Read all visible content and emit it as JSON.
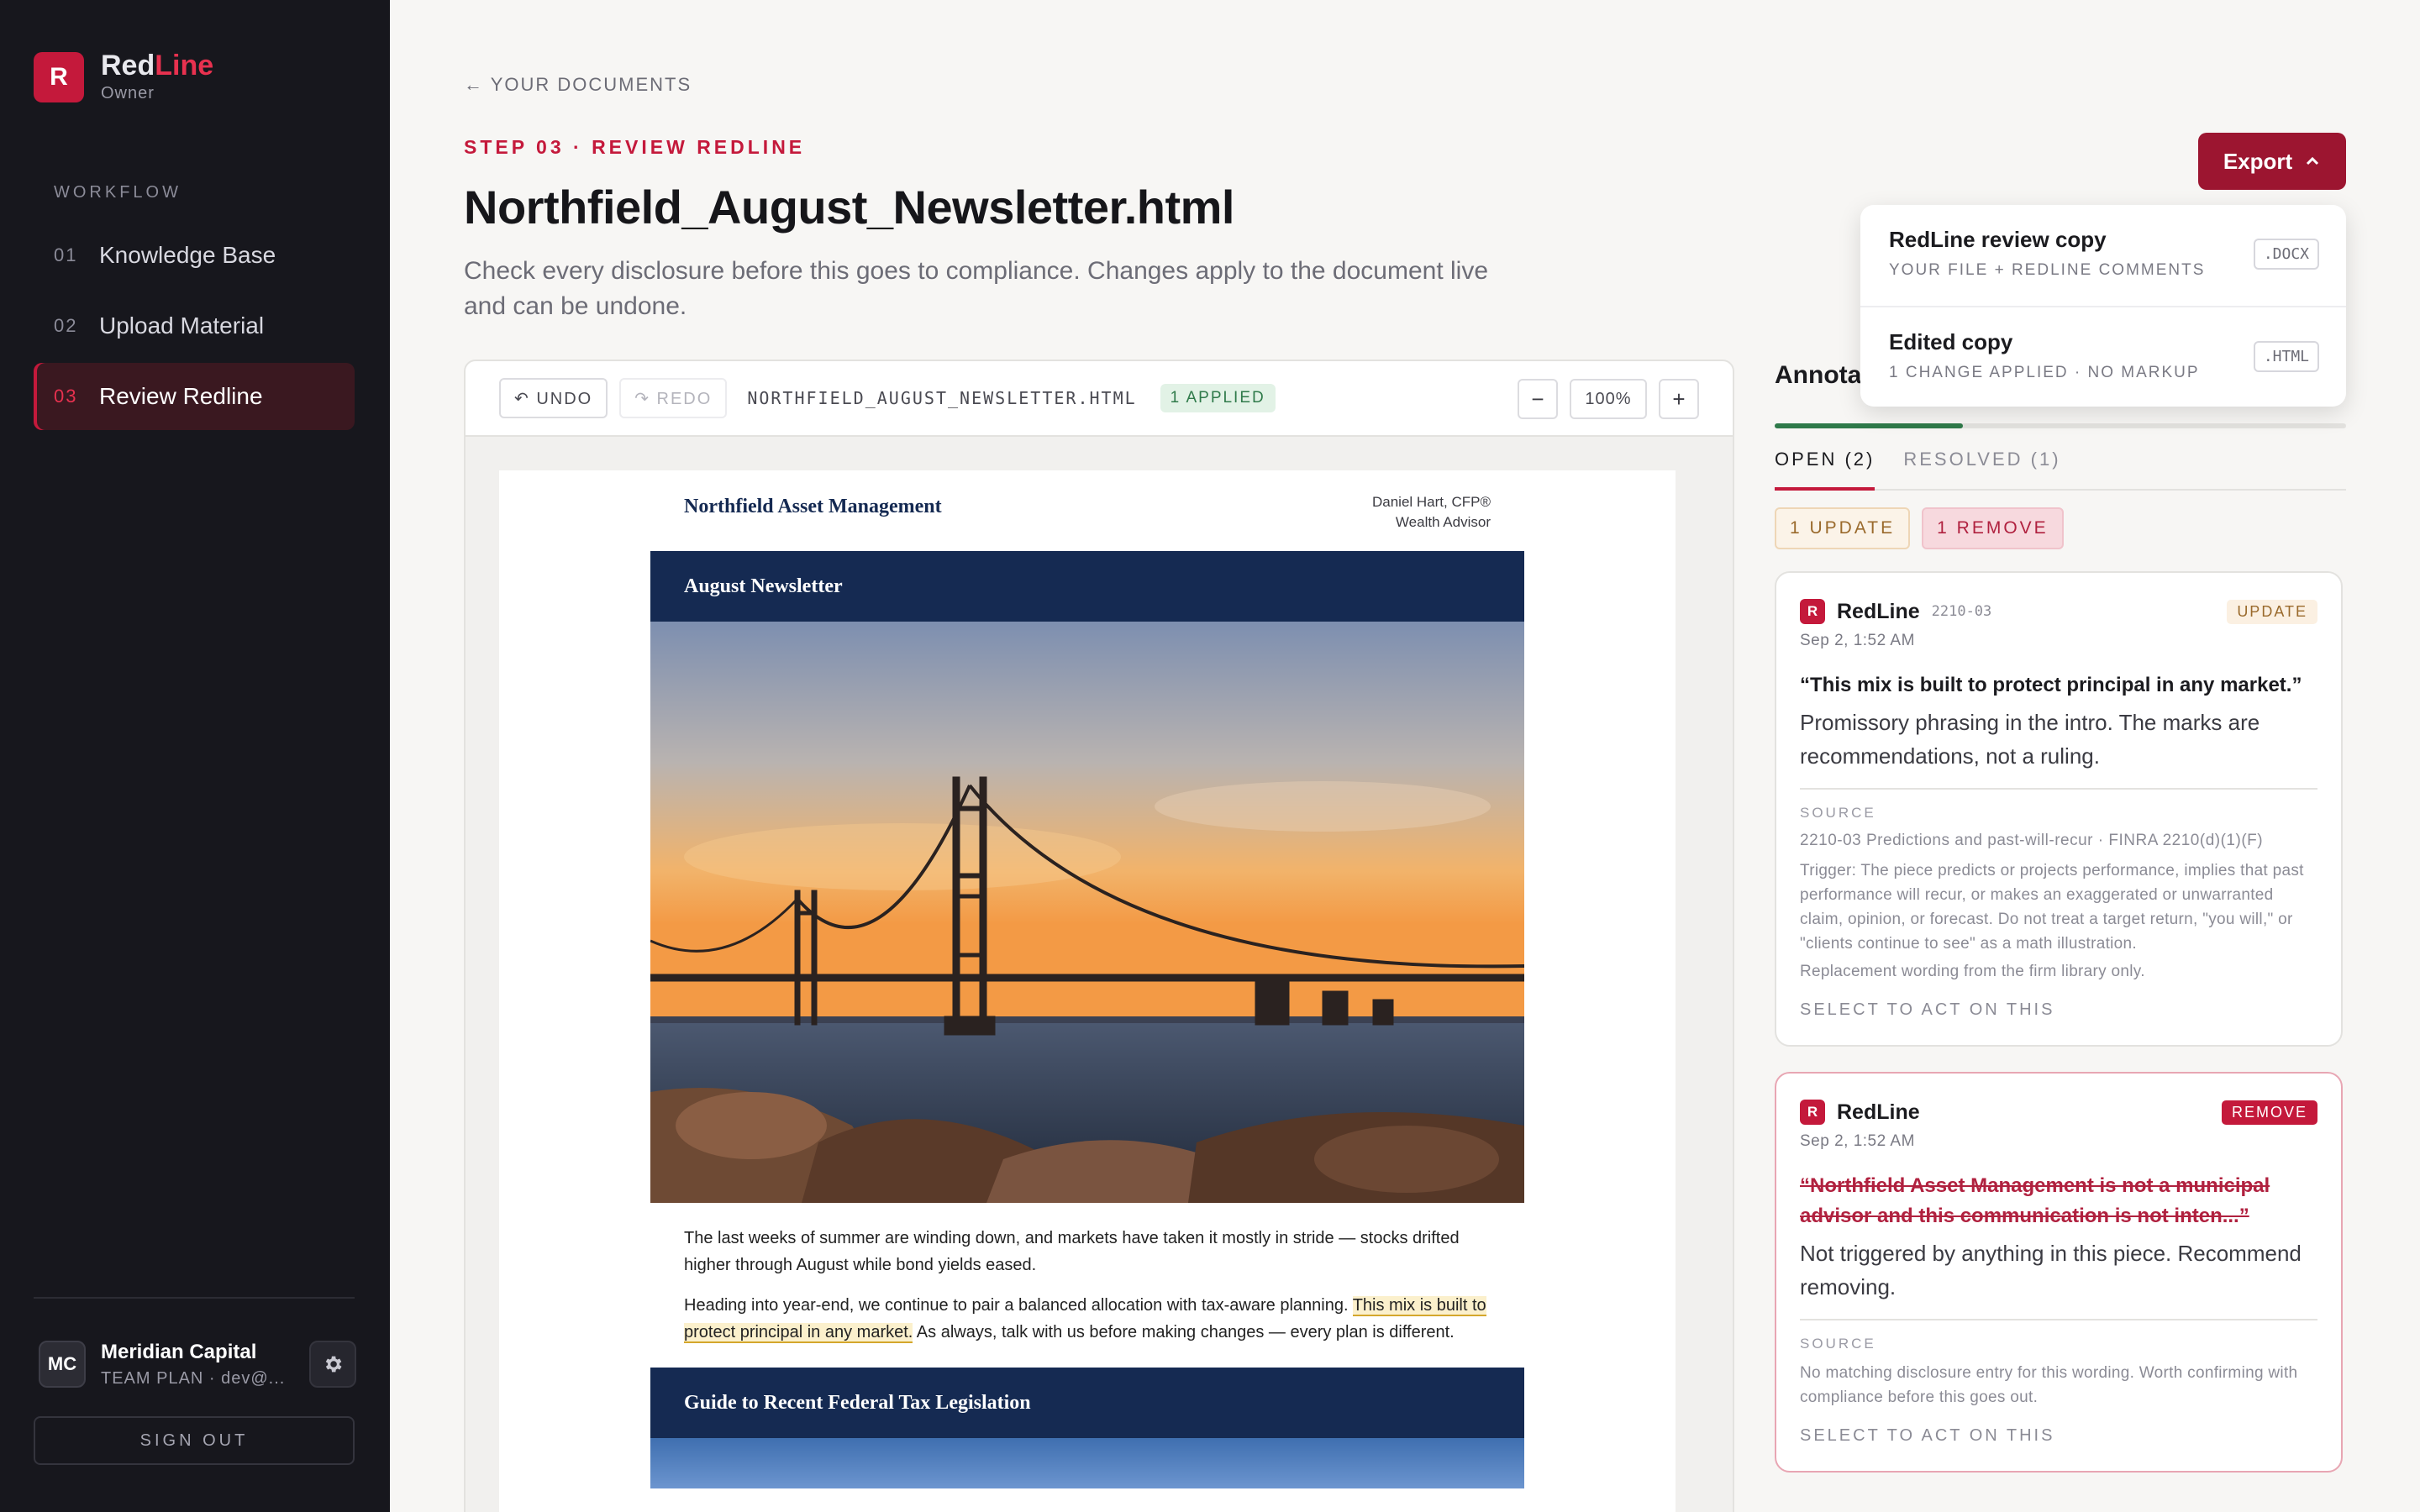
{
  "sidebar": {
    "logo_mark": "R",
    "brand_part1": "Red",
    "brand_part2": "Line",
    "role": "Owner",
    "workflow_title": "WORKFLOW",
    "items": [
      {
        "num": "01",
        "label": "Knowledge Base"
      },
      {
        "num": "02",
        "label": "Upload Material"
      },
      {
        "num": "03",
        "label": "Review Redline"
      }
    ],
    "account": {
      "initials": "MC",
      "name": "Meridian Capital",
      "plan": "TEAM PLAN · dev@..."
    },
    "sign_out": "SIGN OUT"
  },
  "header": {
    "back": "← YOUR DOCUMENTS",
    "step": "STEP 03 · REVIEW REDLINE",
    "title": "Northfield_August_Newsletter.html",
    "description": "Check every disclosure before this goes to compliance. Changes apply to the document live and can be undone."
  },
  "export": {
    "label": "Export",
    "options": [
      {
        "title": "RedLine review copy",
        "sub": "YOUR FILE + REDLINE COMMENTS",
        "ext": ".DOCX"
      },
      {
        "title": "Edited copy",
        "sub": "1 CHANGE APPLIED · NO MARKUP",
        "ext": ".HTML"
      }
    ]
  },
  "toolbar": {
    "undo": "↶ UNDO",
    "redo": "↷ REDO",
    "filename": "NORTHFIELD_AUGUST_NEWSLETTER.HTML",
    "applied": "1 APPLIED",
    "zoom_out": "−",
    "zoom": "100%",
    "zoom_in": "+"
  },
  "newsletter": {
    "firm": "Northfield Asset Management",
    "advisor_name": "Daniel Hart, CFP®",
    "advisor_title": "Wealth Advisor",
    "band_title": "August Newsletter",
    "para1": "The last weeks of summer are winding down, and markets have taken it mostly in stride — stocks drifted higher through August while bond yields eased.",
    "para2_before": "Heading into year-end, we continue to pair a balanced allocation with tax-aware planning. ",
    "para2_highlight": "This mix is built to protect principal in any market.",
    "para2_after": " As always, talk with us before making changes — every plan is different.",
    "section2_title": "Guide to Recent Federal Tax Legislation"
  },
  "annotations": {
    "title": "Annotations",
    "progress": 0.33,
    "tabs": [
      {
        "label": "OPEN (2)"
      },
      {
        "label": "RESOLVED (1)"
      }
    ],
    "chips": [
      {
        "label": "1 UPDATE"
      },
      {
        "label": "1 REMOVE"
      }
    ],
    "cards": [
      {
        "logo": "R",
        "brand": "RedLine",
        "code": "2210-03",
        "tag": "UPDATE",
        "date": "Sep 2, 1:52 AM",
        "quote": "“This mix is built to protect principal in any market.”",
        "note": "Promissory phrasing in the intro. The marks are recommendations, not a ruling.",
        "source_label": "SOURCE",
        "source_ref": "2210-03 Predictions and past-will-recur · FINRA 2210(d)(1)(F)",
        "source_text": "Trigger: The piece predicts or projects performance, implies that past performance will recur, or makes an exaggerated or unwarranted claim, opinion, or forecast. Do not treat a target return, \"you will,\" or \"clients continue to see\" as a math illustration.",
        "source_extra": "Replacement wording from the firm library only.",
        "action": "SELECT TO ACT ON THIS"
      },
      {
        "logo": "R",
        "brand": "RedLine",
        "tag": "REMOVE",
        "date": "Sep 2, 1:52 AM",
        "quote": "“Northfield Asset Management is not a municipal advisor and this communication is not inten...”",
        "note": "Not triggered by anything in this piece. Recommend removing.",
        "source_label": "SOURCE",
        "source_text": "No matching disclosure entry for this wording. Worth confirming with compliance before this goes out.",
        "action": "SELECT TO ACT ON THIS"
      }
    ]
  },
  "colors": {
    "accent": "#c4193b",
    "sidebar_bg": "#17171d",
    "export_bg": "#9c1530",
    "newsletter_navy": "#152a52",
    "progress": "#2f7a4a"
  }
}
